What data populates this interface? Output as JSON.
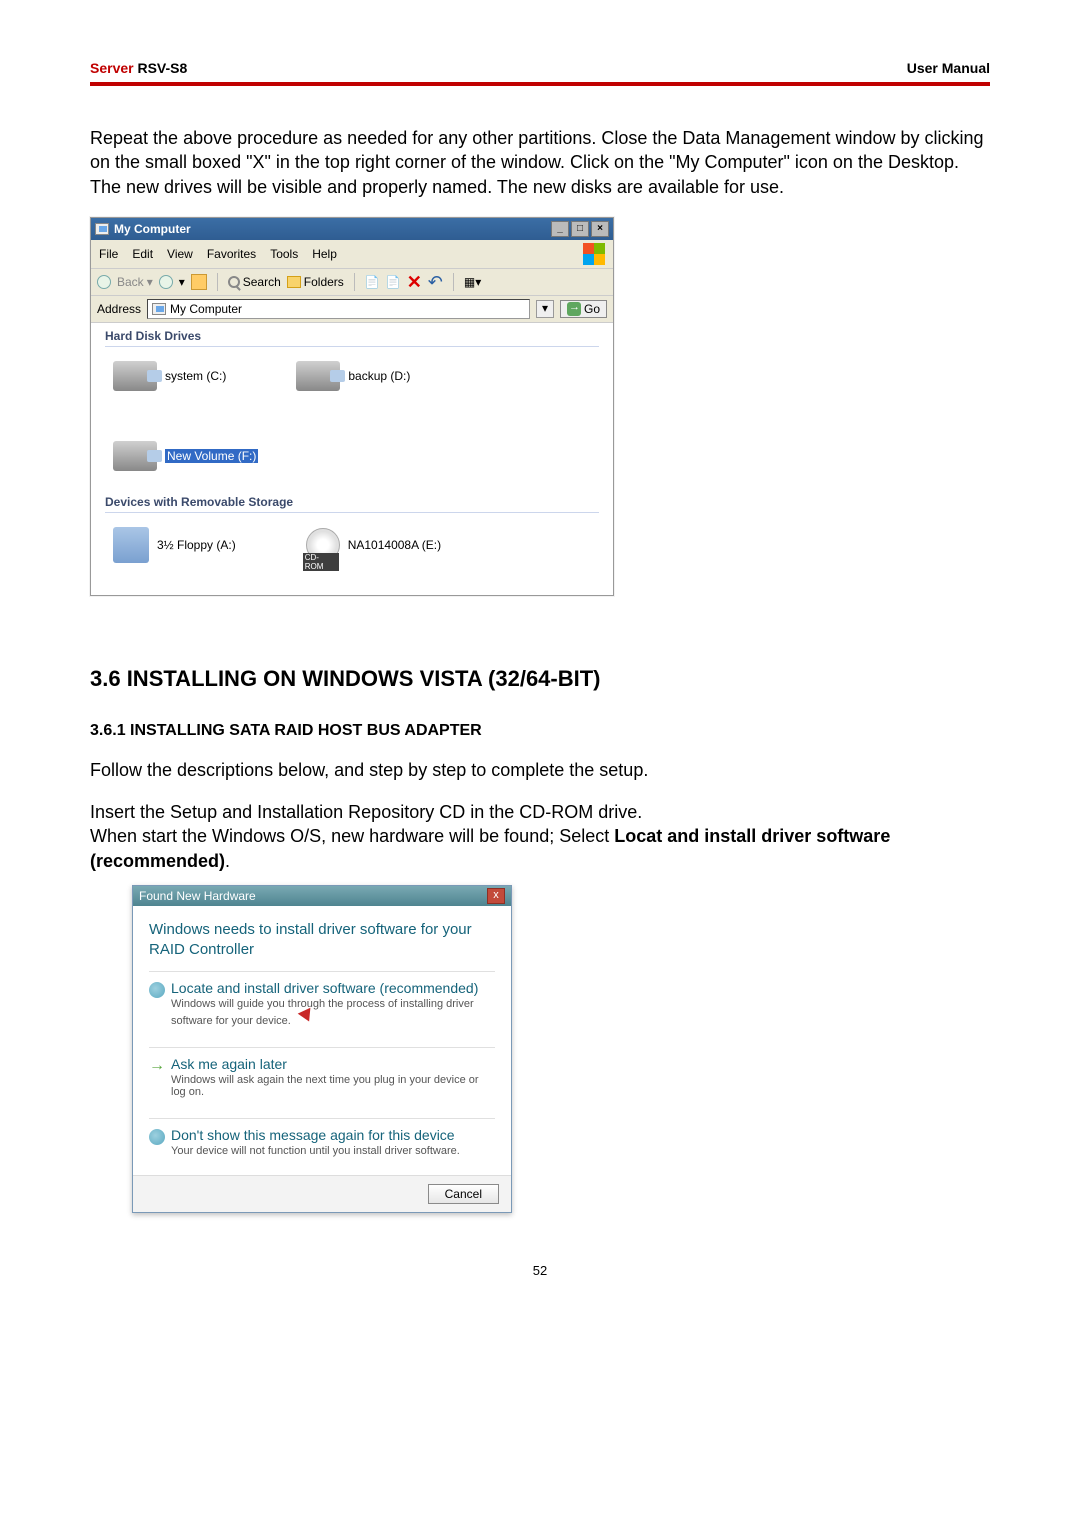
{
  "header": {
    "brand": "Server ",
    "model": "RSV-S8",
    "right": "User Manual"
  },
  "intro": "Repeat the above procedure as needed for any other partitions. Close the Data Management window by clicking on the small boxed \"X\" in the top right corner of the window. Click on the \"My Computer\" icon on the Desktop. The new drives will be visible and properly named. The new disks are available for use.",
  "mycomputer": {
    "title": "My Computer",
    "menu": {
      "file": "File",
      "edit": "Edit",
      "view": "View",
      "favorites": "Favorites",
      "tools": "Tools",
      "help": "Help"
    },
    "toolbar": {
      "back": "Back",
      "search": "Search",
      "folders": "Folders"
    },
    "address": {
      "label": "Address",
      "value": "My Computer",
      "go": "Go"
    },
    "groups": {
      "hdd": "Hard Disk Drives",
      "removable": "Devices with Removable Storage"
    },
    "drives": {
      "c": "system (C:)",
      "d": "backup (D:)",
      "f": "New Volume (F:)",
      "a": "3½ Floppy (A:)",
      "e": "NA1014008A (E:)"
    }
  },
  "section": {
    "h2": "3.6 INSTALLING ON WINDOWS VISTA (32/64-BIT)",
    "h3": "3.6.1 INSTALLING SATA RAID HOST BUS ADAPTER",
    "p1": "Follow the descriptions below, and step by step to complete the setup.",
    "p2a": "Insert the Setup and Installation Repository CD in the CD-ROM drive.",
    "p2b": "When start the Windows O/S, new hardware will be found; Select ",
    "p2bold": "Locat and install driver software (recommended)",
    "p2end": "."
  },
  "vista": {
    "title": "Found New Hardware",
    "heading": "Windows needs to install driver software for your RAID Controller",
    "opt1": {
      "title": "Locate and install driver software (recommended)",
      "sub": "Windows will guide you through the process of installing driver software for your device."
    },
    "opt2": {
      "title": "Ask me again later",
      "sub": "Windows will ask again the next time you plug in your device or log on."
    },
    "opt3": {
      "title": "Don't show this message again for this device",
      "sub": "Your device will not function until you install driver software."
    },
    "cancel": "Cancel"
  },
  "page_number": "52"
}
